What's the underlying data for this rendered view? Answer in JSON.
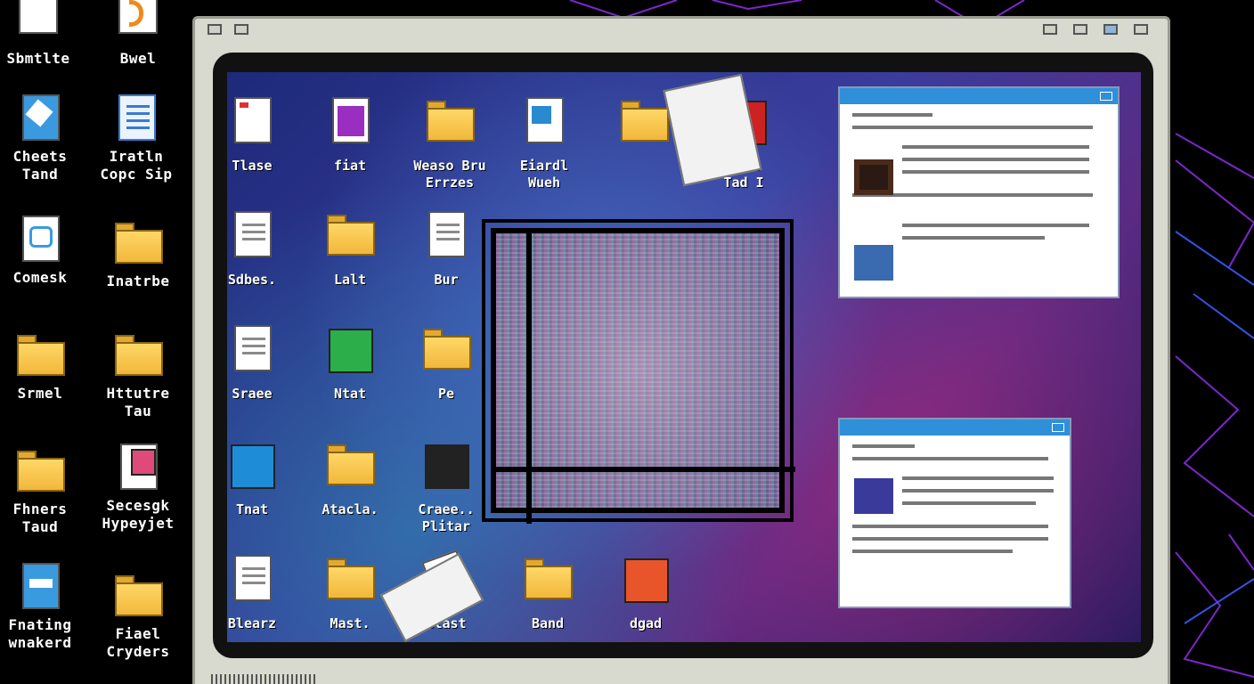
{
  "desktop_icons": [
    {
      "label": "Sbmtlte",
      "kind": "app"
    },
    {
      "label": "Bwel",
      "kind": "app"
    },
    {
      "label": "Cheets\nTand",
      "kind": "doc"
    },
    {
      "label": "Iratln\nCopc Sip",
      "kind": "doc"
    },
    {
      "label": "Comesk",
      "kind": "doc"
    },
    {
      "label": "Inatrbe",
      "kind": "folder"
    },
    {
      "label": "Srmel",
      "kind": "folder"
    },
    {
      "label": "Httutre\nTau",
      "kind": "folder"
    },
    {
      "label": "Fhners\nTaud",
      "kind": "folder"
    },
    {
      "label": "Secesgk\nHypeyjet",
      "kind": "doc"
    },
    {
      "label": "Fnating\nwnakerd",
      "kind": "doc"
    },
    {
      "label": "Fiael\nCryders",
      "kind": "folder"
    }
  ],
  "screen_icons": [
    {
      "label": "Tlase",
      "kind": "doc"
    },
    {
      "label": "fiat",
      "kind": "app"
    },
    {
      "label": "Weaso Bru\nErrzes",
      "kind": "folder"
    },
    {
      "label": "Eiardl\nWueh",
      "kind": "doc"
    },
    {
      "label": "",
      "kind": "folder"
    },
    {
      "label": "Anal\nTad I",
      "kind": "app"
    },
    {
      "label": "Sdbes.",
      "kind": "doc"
    },
    {
      "label": "Lalt",
      "kind": "folder"
    },
    {
      "label": "Bur",
      "kind": "doc"
    },
    {
      "label": "Sraee",
      "kind": "doc"
    },
    {
      "label": "Ntat",
      "kind": "app"
    },
    {
      "label": "Pe",
      "kind": "folder"
    },
    {
      "label": "Tnat",
      "kind": "app"
    },
    {
      "label": "Atacla.",
      "kind": "folder"
    },
    {
      "label": "Craee..\nPlitar",
      "kind": "app"
    },
    {
      "label": "Blearz",
      "kind": "doc"
    },
    {
      "label": "Mast.",
      "kind": "folder"
    },
    {
      "label": "Blast",
      "kind": "doc"
    },
    {
      "label": "Band",
      "kind": "folder"
    },
    {
      "label": "dgad",
      "kind": "app"
    }
  ],
  "colors": {
    "window_titlebar": "#2f8fd8",
    "folder": "#f2b73c",
    "neon_purple": "#9b3cff",
    "monitor_case": "#d8d9cf"
  }
}
